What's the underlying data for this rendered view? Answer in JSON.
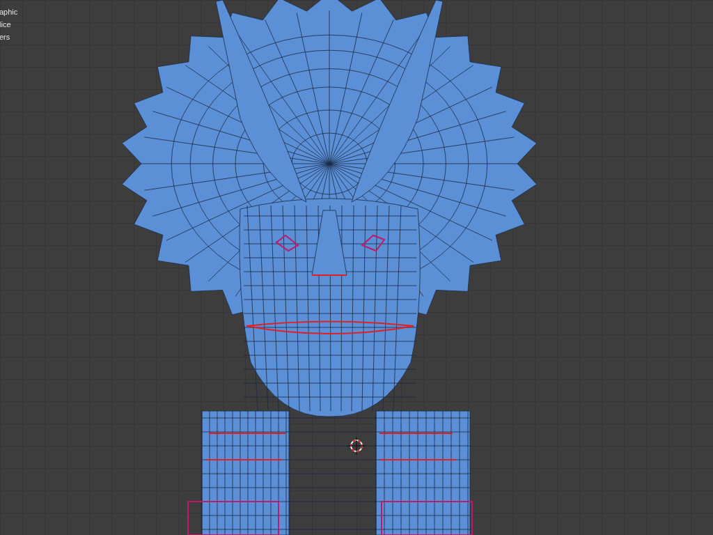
{
  "viewport_overlay": {
    "lines": [
      "aphic",
      "lice",
      "ers"
    ]
  }
}
